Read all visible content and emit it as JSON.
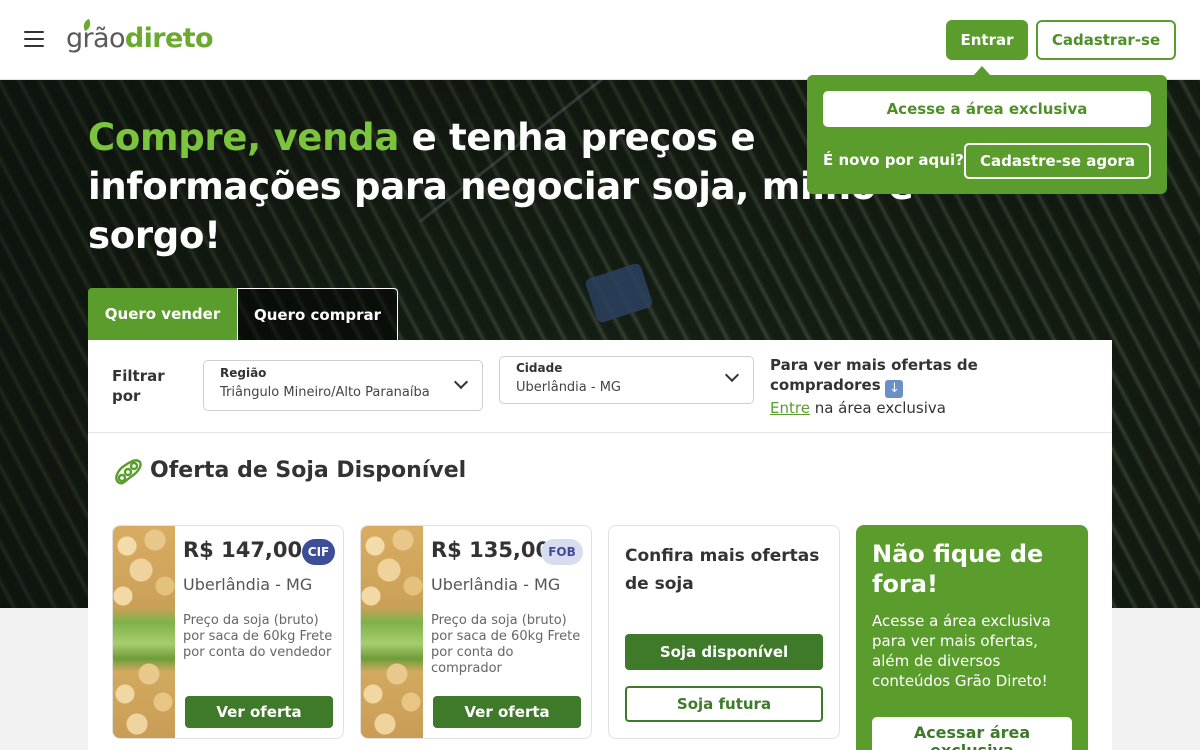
{
  "header": {
    "logo_part1": "grão",
    "logo_part2": "direto",
    "entrar_label": "Entrar",
    "cadastrar_label": "Cadastrar-se"
  },
  "popover": {
    "acesse_label": "Acesse a área exclusiva",
    "novo_text": "É novo por aqui?",
    "cadastre_label": "Cadastre-se agora"
  },
  "hero": {
    "headline_highlight": "Compre, venda",
    "headline_rest_1": " e tenha preços e",
    "headline_line2": "informações para negociar soja, milho e",
    "headline_line3": "sorgo!"
  },
  "tabs": [
    {
      "label": "Quero vender",
      "active": true
    },
    {
      "label": "Quero comprar",
      "active": false
    }
  ],
  "filters": {
    "filtrar_label": "Filtrar por",
    "regiao": {
      "label": "Região",
      "value": "Triângulo Mineiro/Alto Paranaíba"
    },
    "cidade": {
      "label": "Cidade",
      "value": "Uberlândia - MG"
    },
    "more_offers_bold": "Para ver mais ofertas de compradores",
    "more_offers_link": "Entre",
    "more_offers_suffix": " na área exclusiva"
  },
  "section": {
    "title": "Oferta de Soja Disponível"
  },
  "offers": [
    {
      "price": "R$ 147,00",
      "badge": "CIF",
      "city": "Uberlândia - MG",
      "desc": "Preço da soja (bruto) por saca de 60kg Frete por conta do vendedor",
      "button": "Ver oferta"
    },
    {
      "price": "R$ 135,00",
      "badge": "FOB",
      "city": "Uberlândia - MG",
      "desc": "Preço da soja (bruto) por saca de 60kg Frete por conta do comprador",
      "button": "Ver oferta"
    }
  ],
  "more_card": {
    "title": "Confira mais ofertas de soja",
    "btn_disponivel": "Soja disponível",
    "btn_futura": "Soja futura"
  },
  "cta_card": {
    "title": "Não fique de fora!",
    "text": "Acesse a área exclusiva para ver mais ofertas, além de diversos conteúdos Grão Direto!",
    "button": "Acessar área exclusiva"
  },
  "colors": {
    "brand_green": "#5b9d2c",
    "dark_green": "#3f7a2b",
    "highlight_green": "#7cc43e",
    "cif_badge": "#3d4e96"
  }
}
